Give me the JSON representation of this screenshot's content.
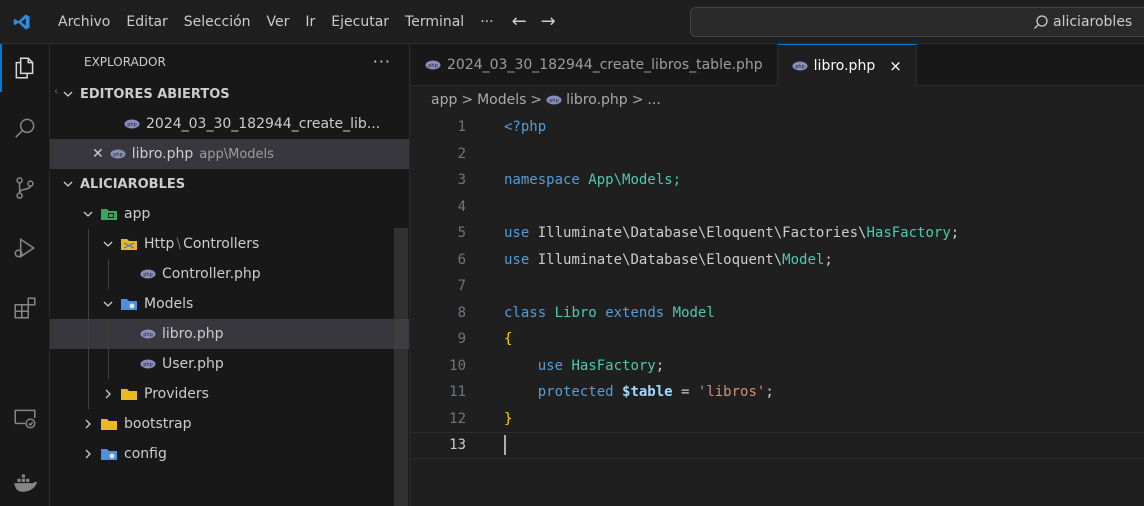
{
  "menu": [
    "Archivo",
    "Editar",
    "Selección",
    "Ver",
    "Ir",
    "Ejecutar",
    "Terminal",
    "···"
  ],
  "search": {
    "text": "aliciarobles"
  },
  "sidebar": {
    "title": "EXPLORADOR",
    "dots": "···",
    "open_editors": {
      "label": "EDITORES ABIERTOS",
      "items": [
        {
          "name": "2024_03_30_182944_create_lib...",
          "path": ""
        },
        {
          "name": "libro.php",
          "path": "app\\Models"
        }
      ]
    },
    "workspace": {
      "label": "ALICIAROBLES",
      "items": [
        {
          "name": "app"
        },
        {
          "name": "Http",
          "suffix": "Controllers"
        },
        {
          "name": "Controller.php"
        },
        {
          "name": "Models"
        },
        {
          "name": "libro.php"
        },
        {
          "name": "User.php"
        },
        {
          "name": "Providers"
        },
        {
          "name": "bootstrap"
        },
        {
          "name": "config"
        }
      ]
    }
  },
  "tabs": [
    {
      "label": "2024_03_30_182944_create_libros_table.php"
    },
    {
      "label": "libro.php",
      "close": "×"
    }
  ],
  "breadcrumb": {
    "a": "app",
    "b": "Models",
    "c": "libro.php",
    "d": "...",
    "sep": ">"
  },
  "code": {
    "line_numbers": [
      "1",
      "2",
      "3",
      "4",
      "5",
      "6",
      "7",
      "8",
      "9",
      "10",
      "11",
      "12",
      "13"
    ],
    "l1": "<?php",
    "l3_kw": "namespace",
    "l3_ns": "App\\Models;",
    "l5_kw": "use",
    "l5_ns": "Illuminate\\Database\\Eloquent\\Factories\\",
    "l5_ty": "HasFactory",
    "l5_end": ";",
    "l6_kw": "use",
    "l6_ns": "Illuminate\\Database\\Eloquent\\",
    "l6_ty": "Model",
    "l6_end": ";",
    "l8_kw1": "class",
    "l8_ty1": "Libro",
    "l8_kw2": "extends",
    "l8_ty2": "Model",
    "l9": "{",
    "l10_kw": "use",
    "l10_ty": "HasFactory",
    "l10_end": ";",
    "l11_kw": "protected",
    "l11_var": "$table",
    "l11_eq": " = ",
    "l11_str": "'libros'",
    "l11_end": ";",
    "l12": "}"
  },
  "colors": {
    "accent": "#0078d4",
    "folder": "#e8b923",
    "php": "#8a8fbd"
  }
}
